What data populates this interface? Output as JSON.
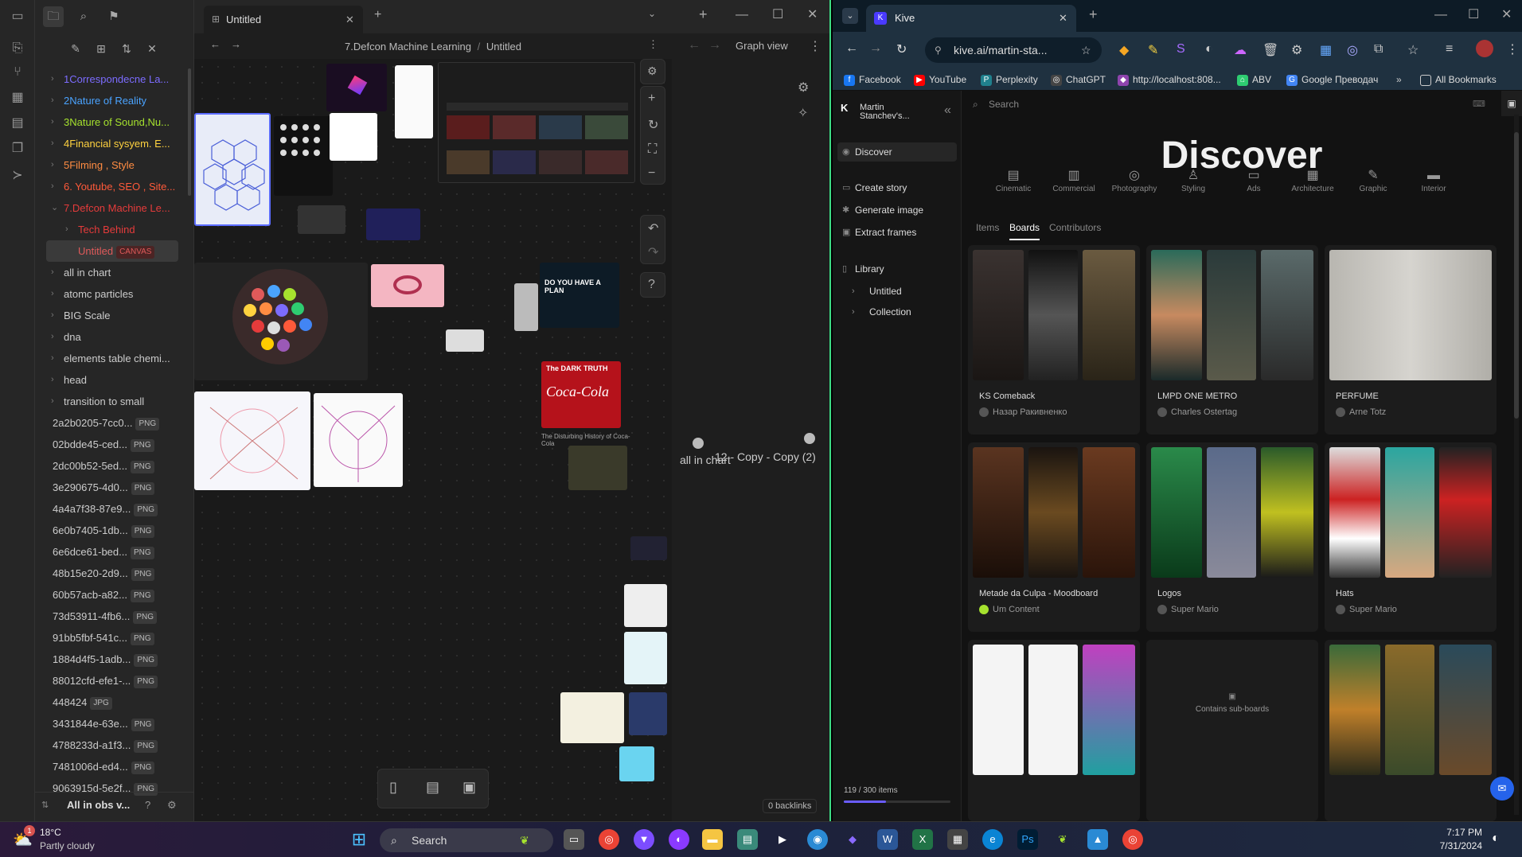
{
  "obsidian": {
    "tab_title": "Untitled",
    "breadcrumb": {
      "folder": "7.Defcon Machine Learning",
      "sep": "/",
      "file": "Untitled"
    },
    "graph_tab_title": "Graph view",
    "backlinks": "0 backlinks",
    "vault_name": "All in obs v...",
    "file_tree": [
      {
        "label": "1Correspondecne La...",
        "color": "#7c6cff",
        "type": "folder"
      },
      {
        "label": "2Nature of Reality",
        "color": "#4aa3ff",
        "type": "folder"
      },
      {
        "label": "3Nature of Sound,Nu...",
        "color": "#a6e22e",
        "type": "folder"
      },
      {
        "label": "4Financial sysyem. E...",
        "color": "#ffd23f",
        "type": "folder"
      },
      {
        "label": "5Filming , Style",
        "color": "#ff8c42",
        "type": "folder"
      },
      {
        "label": "6. Youtube, SEO , Site...",
        "color": "#ff5a3a",
        "type": "folder"
      },
      {
        "label": "7.Defcon Machine Le...",
        "color": "#e63b3b",
        "type": "folder-open"
      },
      {
        "label": "Tech Behind",
        "color": "#e63b3b",
        "type": "subfolder"
      },
      {
        "label": "Untitled",
        "color": "#e05a5a",
        "type": "selected",
        "tag": "CANVAS"
      },
      {
        "label": "all in chart",
        "color": "#cccccc",
        "type": "folder"
      },
      {
        "label": "atomc particles",
        "color": "#cccccc",
        "type": "folder"
      },
      {
        "label": "BIG Scale",
        "color": "#cccccc",
        "type": "folder"
      },
      {
        "label": "dna",
        "color": "#cccccc",
        "type": "folder"
      },
      {
        "label": "elements table chemi...",
        "color": "#cccccc",
        "type": "folder"
      },
      {
        "label": "head",
        "color": "#cccccc",
        "type": "folder"
      },
      {
        "label": "transition to small",
        "color": "#cccccc",
        "type": "folder"
      },
      {
        "label": "2a2b0205-7cc0...",
        "color": "#cccccc",
        "type": "file",
        "tag": "PNG"
      },
      {
        "label": "02bdde45-ced...",
        "color": "#cccccc",
        "type": "file",
        "tag": "PNG"
      },
      {
        "label": "2dc00b52-5ed...",
        "color": "#cccccc",
        "type": "file",
        "tag": "PNG"
      },
      {
        "label": "3e290675-4d0...",
        "color": "#cccccc",
        "type": "file",
        "tag": "PNG"
      },
      {
        "label": "4a4a7f38-87e9...",
        "color": "#cccccc",
        "type": "file",
        "tag": "PNG"
      },
      {
        "label": "6e0b7405-1db...",
        "color": "#cccccc",
        "type": "file",
        "tag": "PNG"
      },
      {
        "label": "6e6dce61-bed...",
        "color": "#cccccc",
        "type": "file",
        "tag": "PNG"
      },
      {
        "label": "48b15e20-2d9...",
        "color": "#cccccc",
        "type": "file",
        "tag": "PNG"
      },
      {
        "label": "60b57acb-a82...",
        "color": "#cccccc",
        "type": "file",
        "tag": "PNG"
      },
      {
        "label": "73d53911-4fb6...",
        "color": "#cccccc",
        "type": "file",
        "tag": "PNG"
      },
      {
        "label": "91bb5fbf-541c...",
        "color": "#cccccc",
        "type": "file",
        "tag": "PNG"
      },
      {
        "label": "1884d4f5-1adb...",
        "color": "#cccccc",
        "type": "file",
        "tag": "PNG"
      },
      {
        "label": "88012cfd-efe1-...",
        "color": "#cccccc",
        "type": "file",
        "tag": "PNG"
      },
      {
        "label": "448424",
        "color": "#cccccc",
        "type": "file",
        "tag": "JPG"
      },
      {
        "label": "3431844e-63e...",
        "color": "#cccccc",
        "type": "file",
        "tag": "PNG"
      },
      {
        "label": "4788233d-a1f3...",
        "color": "#cccccc",
        "type": "file",
        "tag": "PNG"
      },
      {
        "label": "7481006d-ed4...",
        "color": "#cccccc",
        "type": "file",
        "tag": "PNG"
      },
      {
        "label": "9063915d-5e2f...",
        "color": "#cccccc",
        "type": "file",
        "tag": "PNG"
      }
    ],
    "canvas_cards": {
      "video_title": "DO YOU HAVE A PLAN",
      "coke_title": "The DARK TRUTH",
      "coke_brand": "Coca-Cola",
      "coke_caption": "The Disturbing History of Coca-Cola"
    },
    "graph_nodes": [
      {
        "label": "all in chart"
      },
      {
        "label": "12 - Copy - Copy (2)"
      }
    ]
  },
  "chrome": {
    "tab_title": "Kive",
    "url": "kive.ai/martin-sta...",
    "bookmarks": [
      {
        "label": "Facebook",
        "color": "#1877f2",
        "glyph": "f"
      },
      {
        "label": "YouTube",
        "color": "#ff0000",
        "glyph": "▶"
      },
      {
        "label": "Perplexity",
        "color": "#20808d",
        "glyph": "P"
      },
      {
        "label": "ChatGPT",
        "color": "#444444",
        "glyph": "◎"
      },
      {
        "label": "http://localhost:808...",
        "color": "#8e44ad",
        "glyph": "◆"
      },
      {
        "label": "ABV",
        "color": "#2ecc71",
        "glyph": "⌂"
      },
      {
        "label": "Google Преводач",
        "color": "#4285f4",
        "glyph": "G"
      }
    ],
    "all_bookmarks": "All Bookmarks"
  },
  "kive": {
    "user": "Martin Stanchev's...",
    "nav": {
      "discover": "Discover",
      "create_story": "Create story",
      "generate_image": "Generate image",
      "extract_frames": "Extract frames",
      "library": "Library",
      "untitled": "Untitled",
      "collection": "Collection"
    },
    "items_count": "119 / 300 items",
    "usage_fraction": 0.397,
    "search_placeholder": "Search",
    "title": "Discover",
    "categories": [
      "Cinematic",
      "Commercial",
      "Photography",
      "Styling",
      "Ads",
      "Architecture",
      "Graphic",
      "Interior"
    ],
    "tabs": [
      "Items",
      "Boards",
      "Contributors"
    ],
    "boards": [
      {
        "title": "KS Comeback",
        "author": "Назар Ракивненко"
      },
      {
        "title": "LMPD ONE METRO",
        "author": "Charles Ostertag"
      },
      {
        "title": "PERFUME",
        "author": "Arne Totz"
      },
      {
        "title": "Metade da Culpa - Moodboard",
        "author": "Um Content"
      },
      {
        "title": "Logos",
        "author": "Super Mario"
      },
      {
        "title": "Hats",
        "author": "Super Mario"
      },
      {
        "title": "",
        "author": ""
      },
      {
        "title": "Contains sub-boards",
        "author": ""
      },
      {
        "title": "",
        "author": ""
      }
    ]
  },
  "taskbar": {
    "weather_temp": "18°C",
    "weather_desc": "Partly cloudy",
    "weather_badge": "1",
    "search": "Search",
    "time": "7:17 PM",
    "date": "7/31/2024"
  }
}
